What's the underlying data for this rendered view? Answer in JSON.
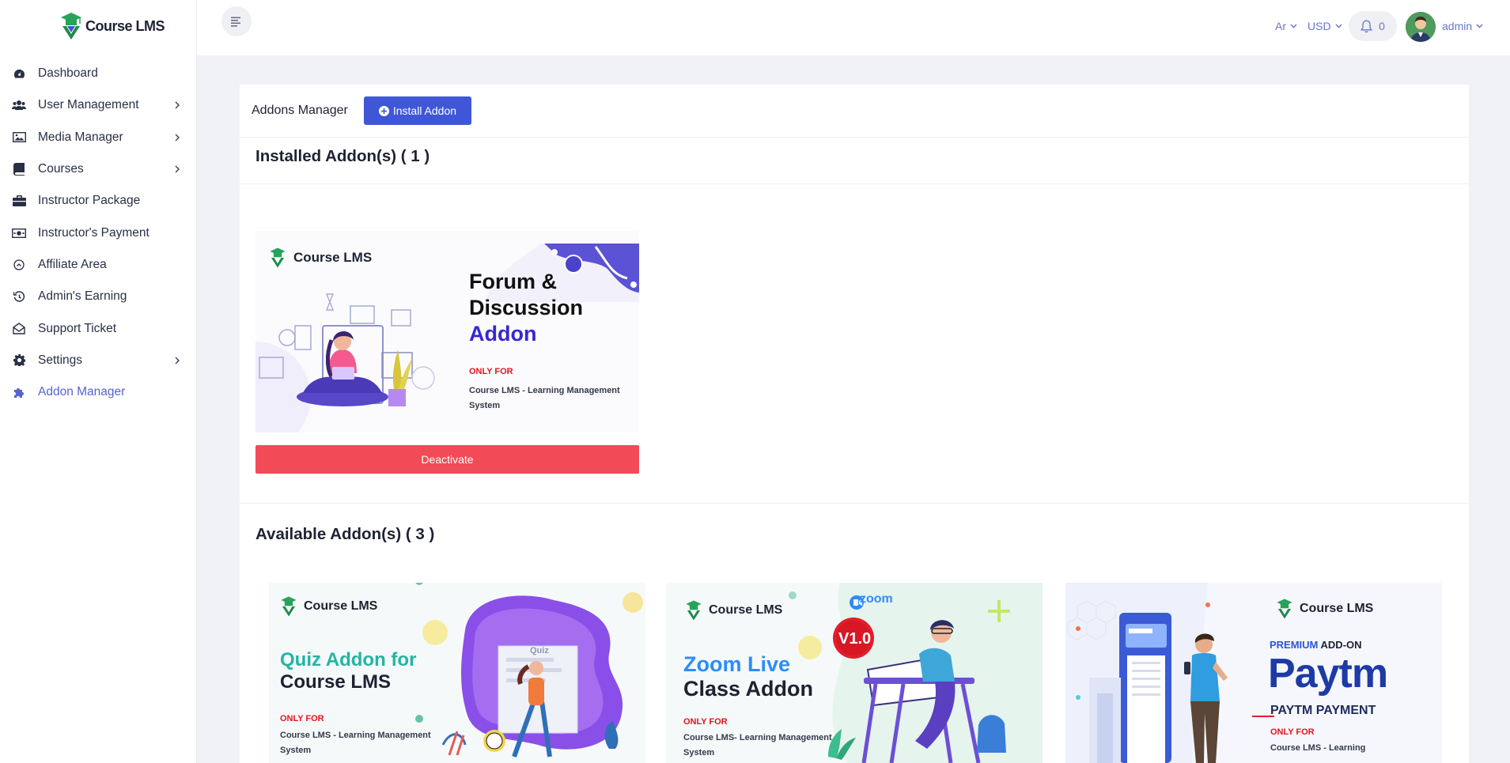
{
  "brand": {
    "name": "Course LMS"
  },
  "sidebar": {
    "items": [
      {
        "label": "Dashboard",
        "icon": "dashboard-icon"
      },
      {
        "label": "User Management",
        "icon": "users-icon",
        "has_submenu": true
      },
      {
        "label": "Media Manager",
        "icon": "image-icon",
        "has_submenu": true
      },
      {
        "label": "Courses",
        "icon": "book-icon",
        "has_submenu": true
      },
      {
        "label": "Instructor Package",
        "icon": "briefcase-icon"
      },
      {
        "label": "Instructor's Payment",
        "icon": "money-icon"
      },
      {
        "label": "Affiliate Area",
        "icon": "affiliate-icon"
      },
      {
        "label": "Admin's Earning",
        "icon": "history-icon"
      },
      {
        "label": "Support Ticket",
        "icon": "envelope-open-icon"
      },
      {
        "label": "Settings",
        "icon": "gear-icon",
        "has_submenu": true
      },
      {
        "label": "Addon Manager",
        "icon": "puzzle-icon",
        "active": true
      }
    ]
  },
  "topbar": {
    "language": "Ar",
    "currency": "USD",
    "notification_count": "0",
    "user_name": "admin"
  },
  "page": {
    "title": "Addons Manager",
    "install_button": "Install Addon",
    "installed_heading": "Installed Addon(s) ( 1 )",
    "available_heading": "Available Addon(s) ( 3 )"
  },
  "installed_addons": [
    {
      "brand": "Course LMS",
      "title_line1": "Forum &",
      "title_line2": "Discussion",
      "title_line3": "Addon",
      "only_for": "ONLY FOR",
      "product_line1": "Course LMS - Learning Management",
      "product_line2": "System",
      "action": "Deactivate"
    }
  ],
  "available_addons": [
    {
      "brand": "Course LMS",
      "title_line1": "Quiz Addon for",
      "title_line2": "Course LMS",
      "art_label": "Quiz",
      "only_for": "ONLY FOR",
      "product_line1": "Course LMS - Learning Management",
      "product_line2": "System"
    },
    {
      "brand": "Course LMS",
      "title_line1": "Zoom Live",
      "title_line2": "Class Addon",
      "badge": "V1.0",
      "zoom_label": "zoom",
      "only_for": "ONLY FOR",
      "product_line1": "Course LMS- Learning Management",
      "product_line2": "System"
    },
    {
      "brand": "Course LMS",
      "premium_prefix": "PREMIUM",
      "premium_suffix": "ADD-ON",
      "paytm_word": "Paytm",
      "subtitle": "PAYTM PAYMENT",
      "only_for": "ONLY FOR",
      "product_line1": "Course LMS - Learning"
    }
  ],
  "colors": {
    "primary": "#3f57d6",
    "danger": "#f24b57",
    "active_nav": "#5664d2",
    "logo_green": "#27a35a",
    "paytm_blue": "#1d3aa6"
  }
}
